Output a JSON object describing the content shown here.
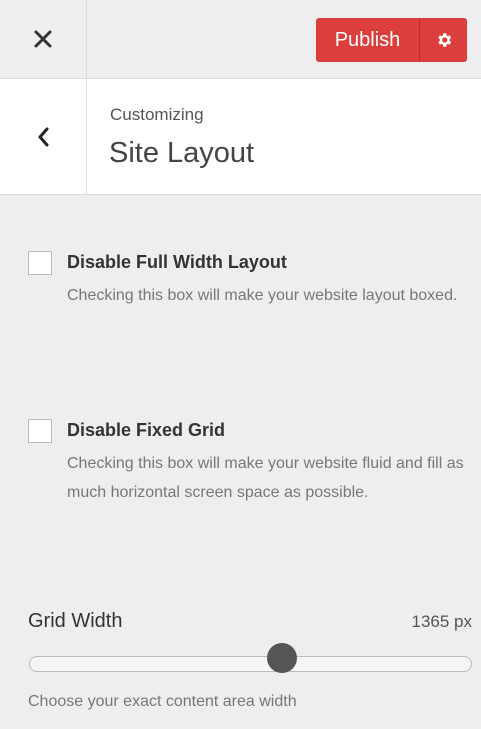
{
  "header": {
    "close_icon": "close-icon",
    "publish_label": "Publish",
    "settings_icon": "gear-icon",
    "accent_color": "#dc3d3d"
  },
  "section": {
    "back_icon": "chevron-left-icon",
    "breadcrumb": "Customizing",
    "title": "Site Layout"
  },
  "controls": [
    {
      "label": "Disable Full Width Layout",
      "description": "Checking this box will make your website layout boxed.",
      "checked": false
    },
    {
      "label": "Disable Fixed Grid",
      "description": "Checking this box will make your website fluid and fill as much horizontal screen space as possible.",
      "checked": false
    }
  ],
  "grid_width": {
    "label": "Grid Width",
    "value_text": "1365 px",
    "value": 1365,
    "level": 0.57,
    "help": "Choose your exact content area width"
  }
}
